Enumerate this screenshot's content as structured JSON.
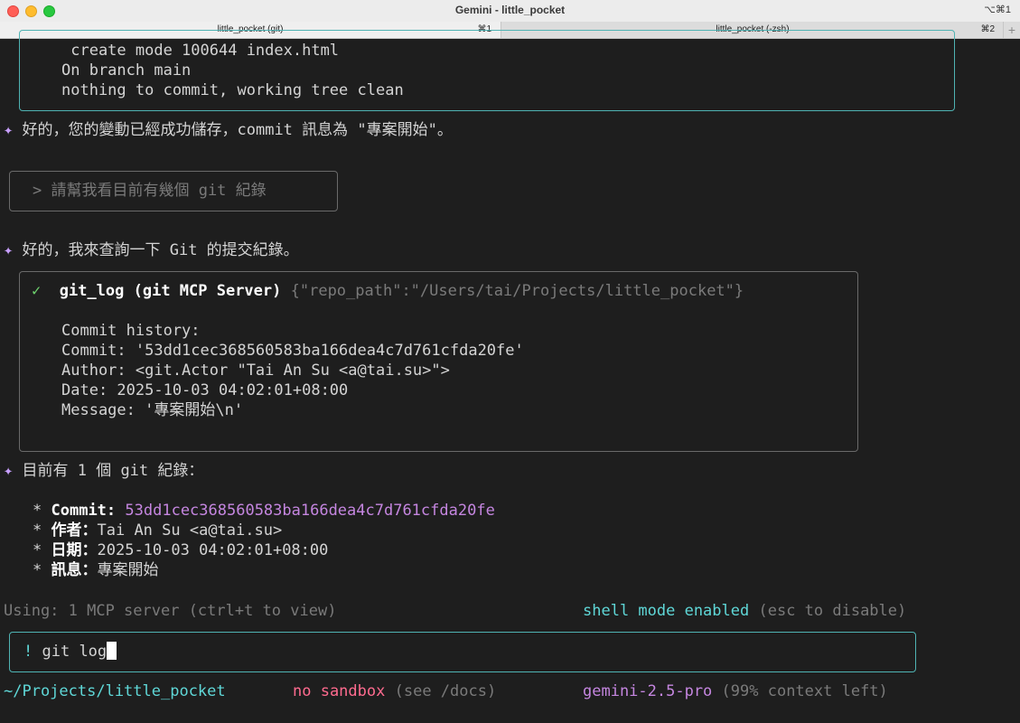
{
  "window": {
    "title": "Gemini - little_pocket",
    "shortcut": "⌥⌘1"
  },
  "tabs": [
    {
      "label": "little_pocket (git)",
      "shortcut": "⌘1"
    },
    {
      "label": "little_pocket (-zsh)",
      "shortcut": "⌘2"
    }
  ],
  "tab_add": "+",
  "top_output": [
    " create mode 100644 index.html",
    "On branch main",
    "nothing to commit, working tree clean"
  ],
  "sparkle": "✦",
  "msg1": "好的，您的變動已經成功儲存，commit 訊息為 \"專案開始\"。",
  "user_prompt": "> 請幫我看目前有幾個 git 紀錄",
  "msg2": "好的，我來查詢一下 Git 的提交紀錄。",
  "tool": {
    "check": "✓",
    "name": "git_log (git MCP Server)",
    "args": "{\"repo_path\":\"/Users/tai/Projects/little_pocket\"}",
    "output": [
      "Commit history:",
      "Commit: '53dd1cec368560583ba166dea4c7d761cfda20fe'",
      "Author: <git.Actor \"Tai An Su <a@tai.su>\">",
      "Date: 2025-10-03 04:02:01+08:00",
      "Message: '專案開始\\n'"
    ]
  },
  "msg3": "目前有 1 個 git 紀錄：",
  "details": {
    "bullet": "*",
    "commit_label": "Commit:",
    "commit_value": "53dd1cec368560583ba166dea4c7d761cfda20fe",
    "author_label": "作者：",
    "author_value": "Tai An Su <a@tai.su>",
    "date_label": "日期：",
    "date_value": "2025-10-03 04:02:01+08:00",
    "message_label": "訊息：",
    "message_value": "專案開始"
  },
  "status": {
    "mcp": "Using: 1 MCP server (ctrl+t to view)",
    "shell_mode": "shell mode enabled",
    "shell_hint": "(esc to disable)"
  },
  "input": {
    "prefix": "!",
    "value": "git log"
  },
  "footer": {
    "cwd": "~/Projects/little_pocket",
    "sandbox": "no sandbox",
    "sandbox_hint": "(see /docs)",
    "model": "gemini-2.5-pro",
    "context": "(99% context left)"
  }
}
